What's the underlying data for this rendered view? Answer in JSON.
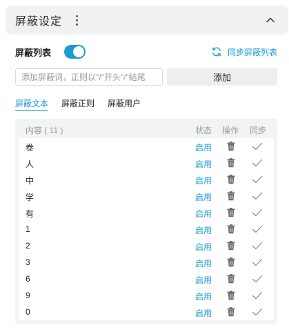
{
  "panel": {
    "title": "屏蔽设定"
  },
  "toggle": {
    "label": "屏蔽列表",
    "enabled": true
  },
  "sync": {
    "label": "同步屏蔽列表"
  },
  "input": {
    "placeholder": "添加屏蔽词，正则以\"/\"开头\"/\"结尾",
    "value": ""
  },
  "add_button": {
    "label": "添加"
  },
  "tabs": [
    {
      "label": "屏蔽文本",
      "active": true
    },
    {
      "label": "屏蔽正则",
      "active": false
    },
    {
      "label": "屏蔽用户",
      "active": false
    }
  ],
  "table": {
    "headers": {
      "content": "内容 ( 11 )",
      "status": "状态",
      "action": "操作",
      "sync": "同步"
    },
    "rows": [
      {
        "content": "卷",
        "status": "启用"
      },
      {
        "content": "人",
        "status": "启用"
      },
      {
        "content": "中",
        "status": "启用"
      },
      {
        "content": "学",
        "status": "启用"
      },
      {
        "content": "有",
        "status": "启用"
      },
      {
        "content": "1",
        "status": "启用"
      },
      {
        "content": "2",
        "status": "启用"
      },
      {
        "content": "3",
        "status": "启用"
      },
      {
        "content": "6",
        "status": "启用"
      },
      {
        "content": "9",
        "status": "启用"
      },
      {
        "content": "0",
        "status": "启用"
      }
    ]
  },
  "colors": {
    "accent": "#1b9ad6",
    "header_bg": "#f0f1f3",
    "table_bg": "#f2f3f5"
  },
  "icons": {
    "menu": "more-vertical-icon",
    "collapse": "chevron-up-icon",
    "sync": "refresh-icon",
    "delete": "trash-icon",
    "synced": "check-icon"
  }
}
